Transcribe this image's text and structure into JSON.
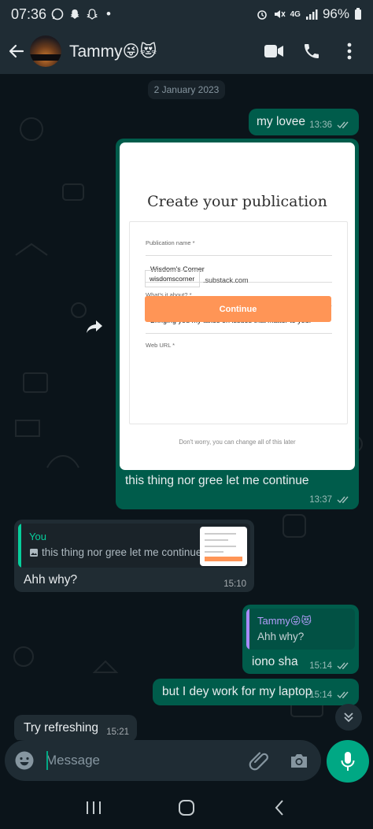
{
  "status_bar": {
    "time": "07:36",
    "dot": "•",
    "network": "4G",
    "battery": "96%",
    "left_icons": [
      "whatsapp-icon",
      "snapchat-icon",
      "snapchat-icon"
    ],
    "right_icons": [
      "alarm-icon",
      "mute-icon",
      "signal-icon",
      "battery-icon"
    ]
  },
  "header": {
    "contact_name": "Tammy😜😻",
    "icons": [
      "back-arrow-icon",
      "video-call-icon",
      "phone-icon",
      "more-vert-icon"
    ]
  },
  "chat": {
    "date_chip": "2 January 2023",
    "messages": [
      {
        "text": "my lovee",
        "time": "13:36",
        "direction": "out"
      },
      {
        "type": "image",
        "direction": "out",
        "image": {
          "title": "Create your publication",
          "publication_label": "Publication name *",
          "publication_value": "Wisdom's Corner",
          "about_label": "What's it about? *",
          "about_value": "Bringing you my takes on issues that matter to you.",
          "url_label": "Web URL *",
          "url_value": "wisdomscorner",
          "url_suffix": ".substack.com",
          "button": "Continue",
          "footer": "Don't worry, you can change all of this later"
        },
        "caption": "this thing nor gree let me continue",
        "time": "13:37"
      },
      {
        "direction": "in",
        "quote": {
          "name": "You",
          "text": "this thing nor gree let me continue"
        },
        "text": "Ahh why?",
        "time": "15:10"
      },
      {
        "direction": "out",
        "quote": {
          "name": "Tammy😜😻",
          "text": "Ahh why?"
        },
        "text": "iono sha",
        "time": "15:14"
      },
      {
        "text": "but I dey work for my laptop",
        "time": "15:14",
        "direction": "out"
      },
      {
        "text": "Try refreshing",
        "time": "15:21",
        "direction": "in"
      }
    ]
  },
  "input": {
    "placeholder": "Message",
    "icons": [
      "emoji-icon",
      "attach-icon",
      "camera-icon",
      "mic-icon"
    ]
  },
  "colors": {
    "outgoing_bubble": "#005c4b",
    "incoming_bubble": "#202c33",
    "accent": "#00a884",
    "header": "#1f2c34",
    "background": "#0b141a"
  }
}
